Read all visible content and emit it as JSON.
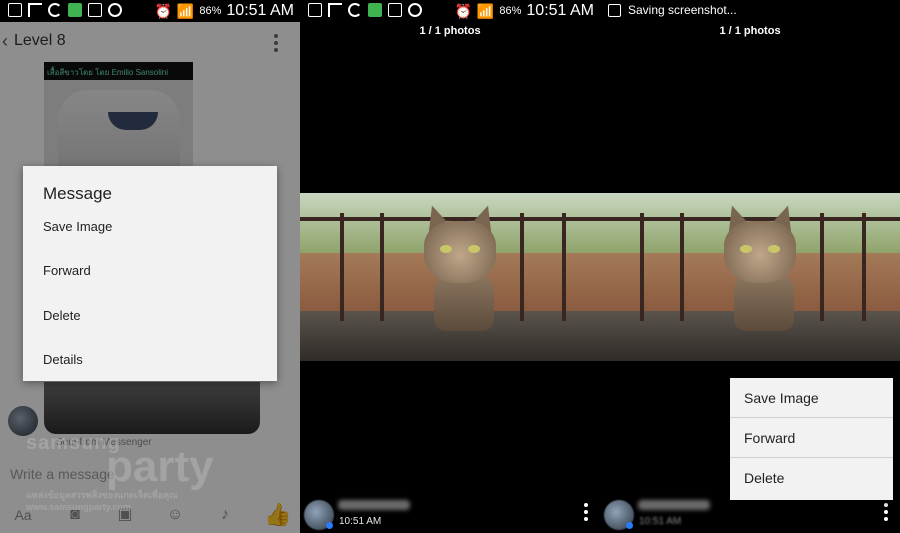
{
  "panel1": {
    "status": {
      "battery": "86%",
      "time": "10:51 AM"
    },
    "conversation_title": "Level 8",
    "shirt_caption": "เสื้อสีขาวโดย โดย Emilio Sansolini",
    "sender_label": "Sent from Messenger",
    "compose_placeholder": "Write a message",
    "bottom_bar": {
      "aa_label": "Aa"
    },
    "watermark": {
      "line1": "samsung",
      "line2": "party",
      "line3": "แหล่งข้อมูลสรรพสิ่งของแกดเจ็ตเพื่อคุณ",
      "line4": "www.samsungparty.com"
    },
    "dialog": {
      "title": "Message",
      "items": [
        "Save Image",
        "Forward",
        "Delete",
        "Details"
      ]
    },
    "colors": {
      "like": "#2b7bff",
      "dim": "rgba(0,0,0,0.42)"
    }
  },
  "panel2": {
    "status": {
      "battery": "86%",
      "time": "10:51 AM"
    },
    "photo_counter": "1 / 1 photos",
    "footer": {
      "time": "10:51 AM"
    }
  },
  "panel3": {
    "status_text": "Saving screenshot...",
    "photo_counter": "1 / 1 photos",
    "footer": {
      "time": "10:51 AM"
    },
    "menu": {
      "items": [
        "Save Image",
        "Forward",
        "Delete"
      ]
    }
  }
}
